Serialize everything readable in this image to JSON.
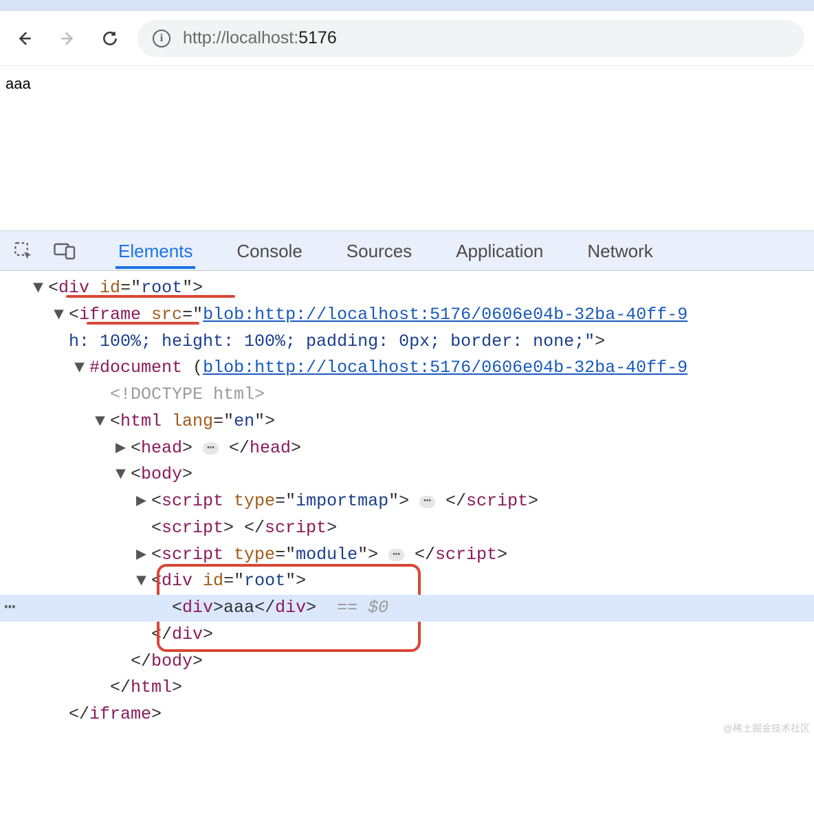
{
  "toolbar": {
    "url_prefix": "http://localhost:",
    "url_port": "5176"
  },
  "viewport": {
    "content": "aaa"
  },
  "devtools": {
    "tabs": [
      "Elements",
      "Console",
      "Sources",
      "Application",
      "Network"
    ],
    "active_tab": "Elements",
    "tree": {
      "blob_url": "blob:http://localhost:5176/0606e04b-32ba-40ff-9",
      "style_fragment": "h: 100%; height: 100%; padding: 0px; border: none;\"",
      "doctype": "<!DOCTYPE html>",
      "html_lang": "en",
      "script1_type": "importmap",
      "script3_type": "module",
      "inner_root_id": "root",
      "inner_text": "aaa",
      "sel_suffix": "== $0",
      "closers": {
        "innerdiv": "</div>",
        "body": "</body>",
        "html": "</html>",
        "iframe": "</iframe>"
      }
    }
  },
  "watermark": "@稀土掘金技术社区"
}
